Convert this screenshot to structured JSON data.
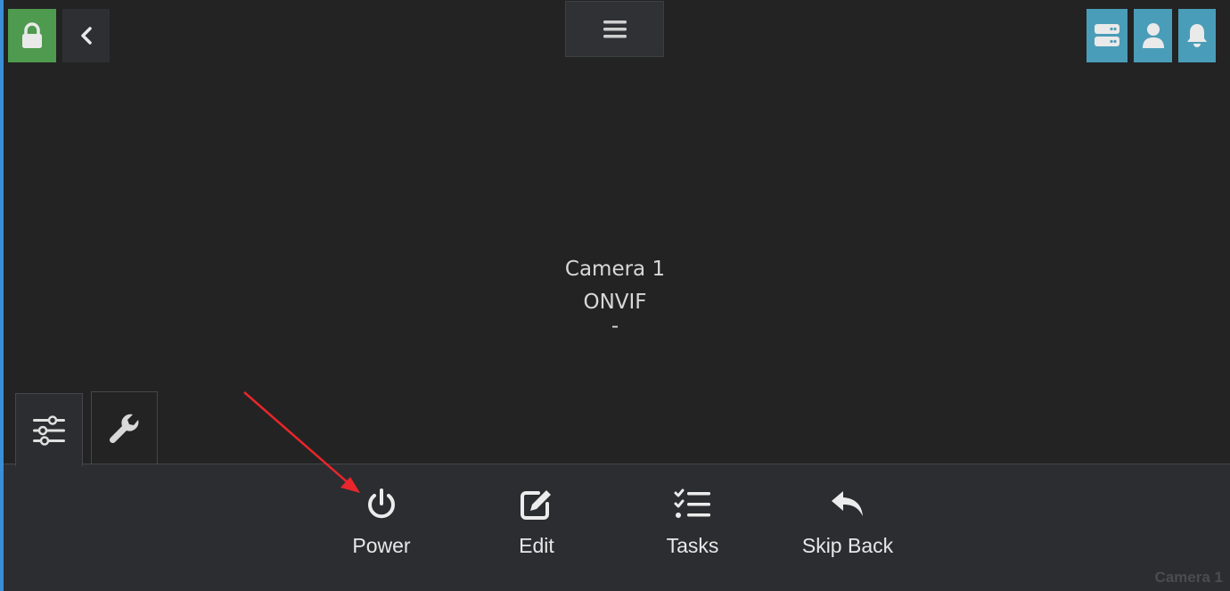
{
  "colors": {
    "background": "#232323",
    "panel": "#2c2d31",
    "lock_green": "#4e9a4f",
    "header_blue": "#4a9db8",
    "annotation_red": "#e8262b"
  },
  "header": {
    "lock_icon": "lock-icon",
    "back_icon": "chevron-left-icon",
    "menu_icon": "hamburger-menu-icon",
    "right_icons": [
      "server-icon",
      "user-icon",
      "bell-icon"
    ]
  },
  "camera": {
    "name": "Camera 1",
    "type": "ONVIF",
    "status": "-"
  },
  "tabs": [
    {
      "icon": "sliders-icon",
      "active": true
    },
    {
      "icon": "wrench-icon",
      "active": false
    }
  ],
  "actions": [
    {
      "label": "Power",
      "icon": "power-icon"
    },
    {
      "label": "Edit",
      "icon": "edit-icon"
    },
    {
      "label": "Tasks",
      "icon": "tasks-icon"
    },
    {
      "label": "Skip Back",
      "icon": "skip-back-icon"
    }
  ],
  "footer": {
    "label": "Camera 1"
  }
}
